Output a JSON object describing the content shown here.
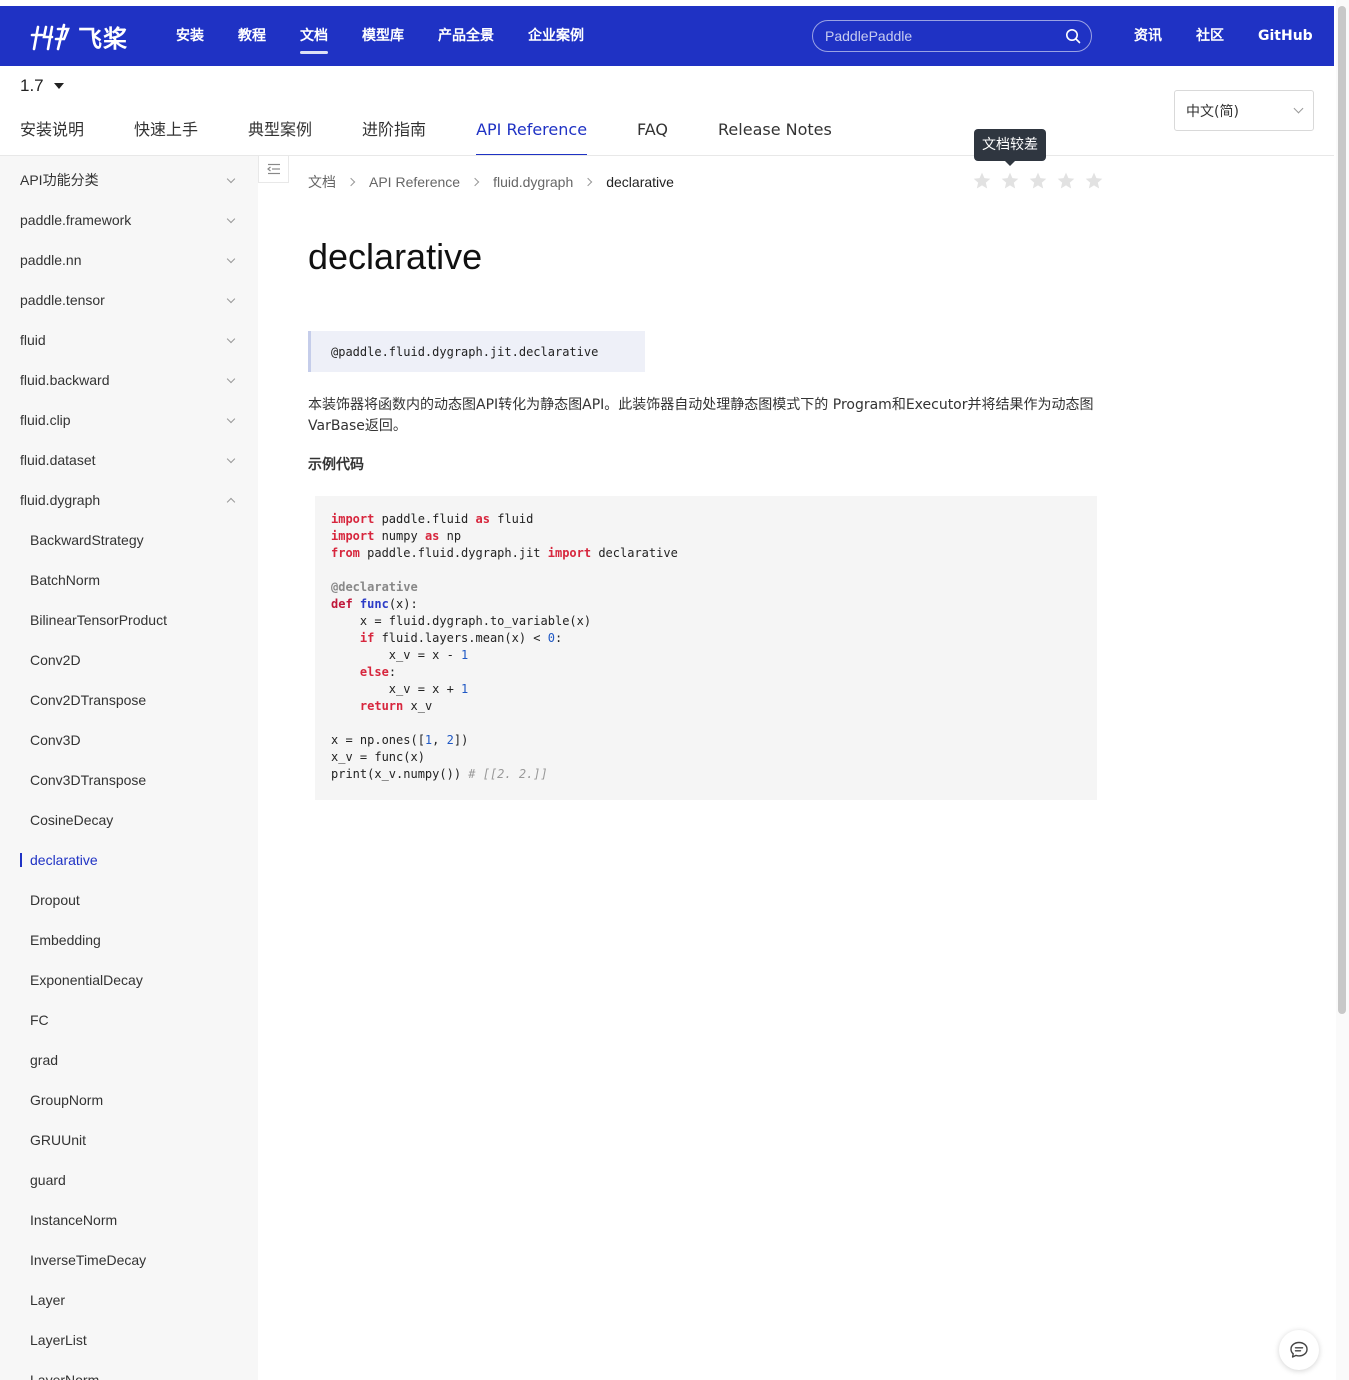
{
  "header": {
    "logo_text": "飞桨",
    "nav": [
      {
        "label": "安装",
        "active": false
      },
      {
        "label": "教程",
        "active": false
      },
      {
        "label": "文档",
        "active": true
      },
      {
        "label": "模型库",
        "active": false
      },
      {
        "label": "产品全景",
        "active": false
      },
      {
        "label": "企业案例",
        "active": false
      }
    ],
    "search_placeholder": "PaddlePaddle",
    "right_nav": [
      "资讯",
      "社区",
      "GitHub"
    ]
  },
  "version": "1.7",
  "subnav": [
    {
      "label": "安装说明",
      "active": false
    },
    {
      "label": "快速上手",
      "active": false
    },
    {
      "label": "典型案例",
      "active": false
    },
    {
      "label": "进阶指南",
      "active": false
    },
    {
      "label": "API Reference",
      "active": true
    },
    {
      "label": "FAQ",
      "active": false
    },
    {
      "label": "Release Notes",
      "active": false
    }
  ],
  "language": "中文(简)",
  "sidebar": {
    "groups": [
      "API功能分类",
      "paddle.framework",
      "paddle.nn",
      "paddle.tensor",
      "fluid",
      "fluid.backward",
      "fluid.clip",
      "fluid.dataset",
      "fluid.dygraph"
    ],
    "children": [
      "BackwardStrategy",
      "BatchNorm",
      "BilinearTensorProduct",
      "Conv2D",
      "Conv2DTranspose",
      "Conv3D",
      "Conv3DTranspose",
      "CosineDecay",
      "declarative",
      "Dropout",
      "Embedding",
      "ExponentialDecay",
      "FC",
      "grad",
      "GroupNorm",
      "GRUUnit",
      "guard",
      "InstanceNorm",
      "InverseTimeDecay",
      "Layer",
      "LayerList",
      "LayerNorm"
    ],
    "active_child": "declarative"
  },
  "breadcrumb": [
    "文档",
    "API Reference",
    "fluid.dygraph",
    "declarative"
  ],
  "rating": {
    "stars": 5,
    "tooltip": "文档较差"
  },
  "page": {
    "title": "declarative",
    "signature": "@paddle.fluid.dygraph.jit.declarative",
    "description": "本装饰器将函数内的动态图API转化为静态图API。此装饰器自动处理静态图模式下的 Program和Executor并将结果作为动态图VarBase返回。",
    "example_title": "示例代码"
  },
  "colors": {
    "brand": "#1f32c4",
    "sidebar_bg": "#f7f7f7",
    "code_bg": "#f5f5f5"
  }
}
